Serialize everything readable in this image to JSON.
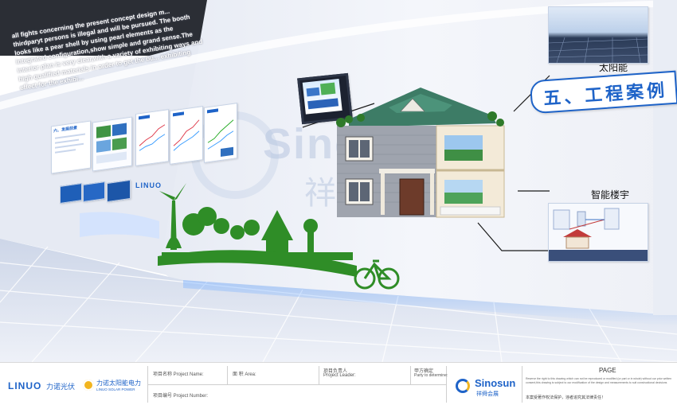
{
  "wall": {
    "overlay_text": "all fights concerning the present concept design m... thirdparyt persons is illegal and will be pursued. The booth looks like a pear shell by using pearl elements as the integrated configuration,show simple and grand sense.The interior plan is very clear,with a variety of exhibiting ways and high qualified materials in order to get the bu... exhibiting effect for the exhibi...",
    "section_title": "五、工程案例",
    "left_panel_title": "六、发展前景",
    "solar_label": "太阳能",
    "smart_building_label": "智能楼宇",
    "linuo_wall_logo": "LINUO",
    "watermark_main": "Sinosun",
    "watermark_cn": "祥"
  },
  "footer": {
    "linuo_logo": "LINUO",
    "linuo_cn": "力诺光伏",
    "solar_power_cn": "力诺太阳能电力",
    "solar_power_en": "LINUO SOLAR POWER",
    "project_name_label": "项目名称 Project Name:",
    "area_label": "面 积 Area:",
    "project_leader_label_cn": "项目负责人",
    "project_leader_label_en": "Project Leader:",
    "party_label_cn": "甲方确定",
    "party_label_en": "Party to determine:",
    "project_number_label": "项目编号 Project Number:",
    "sinosun_logo": "Sinosun",
    "sinosun_cn": "祥舜会展",
    "page_label": "PAGE",
    "rights_text": "Reserve the right to this drawing which can not be reproduced or modified (or part or in whole) without our prior written consent,this drawing is subject to our modification of the design and measurements to suit constructional decisions",
    "rights_cn": "本案受著作权法保护，违者追究其法律责任！"
  },
  "colors": {
    "wall": "#eef1f7",
    "accent_blue": "#1e63c8",
    "green": "#2f8d27",
    "floor": "#dbe2ef",
    "ceiling": "#2a2d33"
  }
}
